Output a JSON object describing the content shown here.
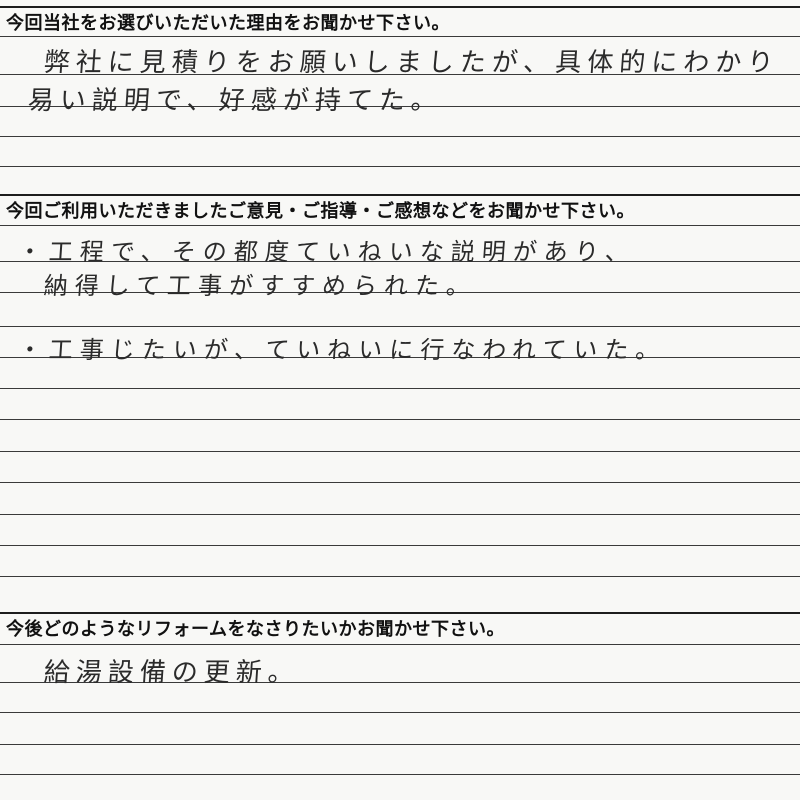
{
  "sections": [
    {
      "heading": "今回当社をお選びいただいた理由をお聞かせ下さい。",
      "lines": [
        "弊社に見積りをお願いしましたが、具体的にわかり",
        "易い説明で、好感が持てた。"
      ]
    },
    {
      "heading": "今回ご利用いただきましたご意見・ご指導・ご感想などをお聞かせ下さい。",
      "lines": [
        "・工程で、その都度ていねいな説明があり、",
        "納得して工事がすすめられた。",
        "・工事じたいが、ていねいに行なわれていた。"
      ]
    },
    {
      "heading": "今後どのようなリフォームをなさりたいかお聞かせ下さい。",
      "lines": [
        "給湯設備の更新。"
      ]
    }
  ]
}
